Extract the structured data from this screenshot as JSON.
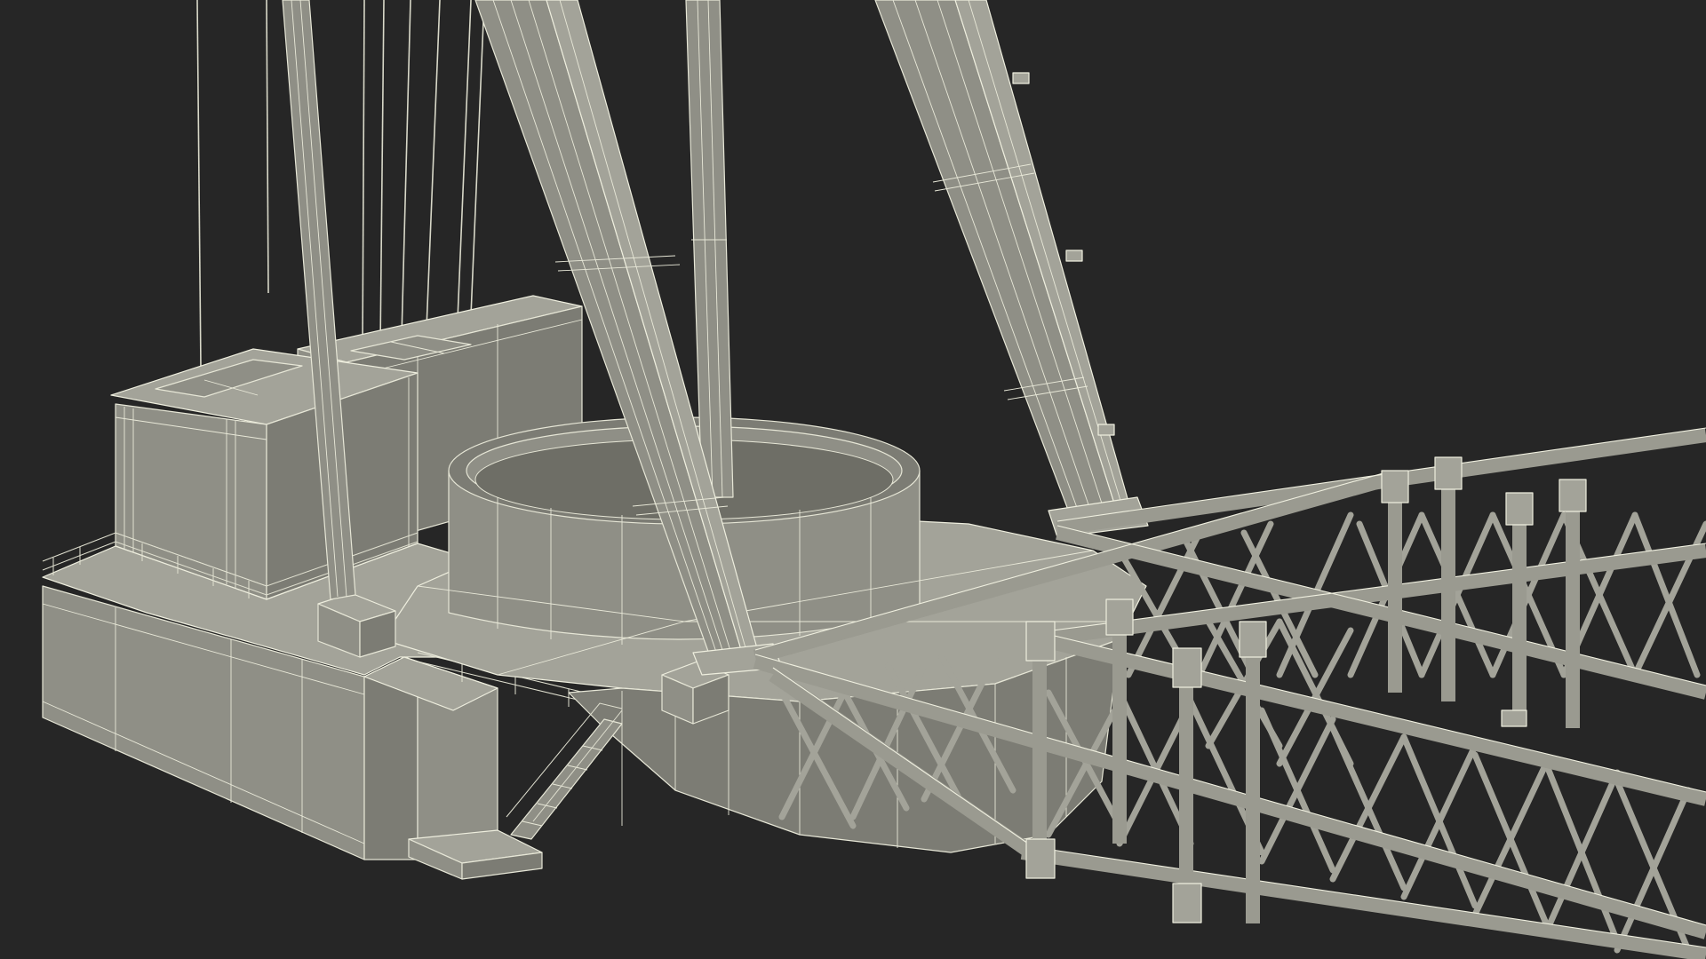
{
  "scene": {
    "subject": "crane-vessel-wireframe-render",
    "colors": {
      "background": "#262626",
      "surface": "#8f8f86",
      "surface_dark": "#7c7c74",
      "surface_light": "#a3a399",
      "wireframe": "#e6e6d6"
    }
  }
}
